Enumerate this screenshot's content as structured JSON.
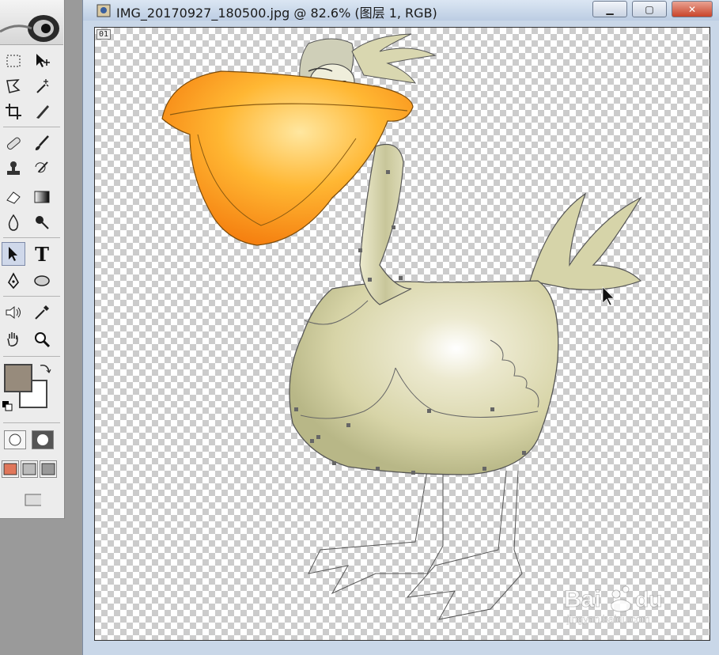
{
  "app": {
    "name": "Photoshop"
  },
  "document": {
    "title": "IMG_20170927_180500.jpg @ 82.6% (图层 1, RGB)",
    "channel_label": "01",
    "window_buttons": {
      "minimize": "▁",
      "maximize": "▢",
      "close": "✕"
    }
  },
  "toolbox": {
    "foreground_color": "#978b7c",
    "background_color": "#ffffff",
    "active_tool": "path-selection-tool",
    "tools": [
      "marquee-tool",
      "move-tool",
      "lasso-tool",
      "magic-wand-tool",
      "crop-tool",
      "slice-tool",
      "healing-brush-tool",
      "brush-tool",
      "clone-stamp-tool",
      "history-brush-tool",
      "eraser-tool",
      "gradient-tool",
      "blur-tool",
      "dodge-tool",
      "path-selection-tool",
      "type-tool",
      "pen-tool",
      "ellipse-tool",
      "notes-tool",
      "eyedropper-tool",
      "hand-tool",
      "zoom-tool"
    ],
    "type_tool_glyph": "T"
  },
  "colors": {
    "beak": "#f7941d",
    "body": "#dcdab0",
    "titlebar": "#c9d7e8"
  }
}
